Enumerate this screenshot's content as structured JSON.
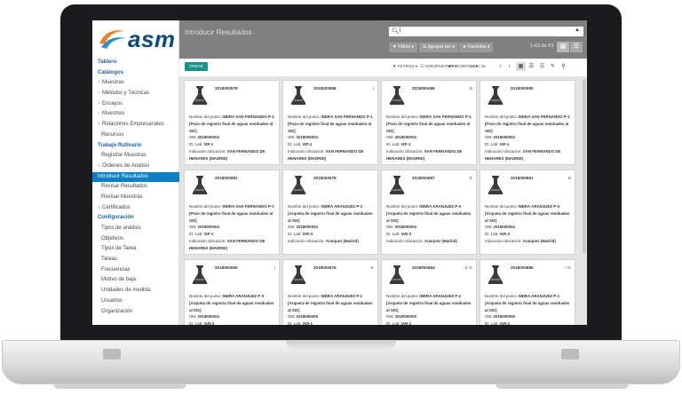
{
  "brand": {
    "logo_text": "asm"
  },
  "sidebar": {
    "items": [
      {
        "label": "Tablero",
        "kind": "section"
      },
      {
        "label": "Catálogos",
        "kind": "section"
      },
      {
        "label": "Muestras",
        "kind": "caret"
      },
      {
        "label": "Métodos y Técnicas",
        "kind": "caret"
      },
      {
        "label": "Ensayos",
        "kind": "caret"
      },
      {
        "label": "Muestreo",
        "kind": "caret"
      },
      {
        "label": "Relaciones Empresariales",
        "kind": "caret"
      },
      {
        "label": "Recursos",
        "kind": "sub"
      },
      {
        "label": "Trabajo Rutinario",
        "kind": "section"
      },
      {
        "label": "Registrar Muestras",
        "kind": "sub"
      },
      {
        "label": "Órdenes de Análisis",
        "kind": "caret"
      },
      {
        "label": "Introducir Resultados",
        "kind": "active"
      },
      {
        "label": "Revisar Resultados",
        "kind": "sub"
      },
      {
        "label": "Revisar Muestras",
        "kind": "sub"
      },
      {
        "label": "Certificados",
        "kind": "caret"
      },
      {
        "label": "Configuración",
        "kind": "section"
      },
      {
        "label": "Tipos de análisis",
        "kind": "sub"
      },
      {
        "label": "Objetivos",
        "kind": "sub"
      },
      {
        "label": "Tipos de Tarea",
        "kind": "sub"
      },
      {
        "label": "Tareas",
        "kind": "sub"
      },
      {
        "label": "Frecuencias",
        "kind": "sub"
      },
      {
        "label": "Motivo de baja",
        "kind": "sub"
      },
      {
        "label": "Unidades de medida",
        "kind": "sub"
      },
      {
        "label": "Usuarios",
        "kind": "sub"
      },
      {
        "label": "Organización",
        "kind": "sub"
      }
    ]
  },
  "topbar": {
    "title": "Introducir Resultados",
    "search_icon": "search-icon",
    "search_value": "|",
    "filters_label": "▼ Filtros ▾",
    "group_label": "☰ Agrupar por ▾",
    "favorites_label": "★ Favoritos ▾",
    "pager": "1-63 de 63"
  },
  "subbar": {
    "create_label": "CREAR",
    "filters_label": "▼ FILTROS ▾",
    "group_label": "☰ AGRUPAR POR ▾",
    "favorites_label": "★ FAVORITOS ▾",
    "pager": "1-15 / 15"
  },
  "cards": [
    {
      "code": "2018000579",
      "tag": "",
      "point": "INDRA SAN FERNANDO P-1",
      "desc": "[Pozo de registro final de aguas residuales al SIS]",
      "om": "2018000004",
      "lab": "ISF-1",
      "loc": "SAN FERNANDO DE HENARES (MADRID)"
    },
    {
      "code": "2018000588",
      "tag": "I",
      "point": "INDRA SAN FERNANDO P-1",
      "desc": "[Pozo de registro final de aguas residuales al SIS]",
      "om": "2018000004",
      "lab": "ISF-1",
      "loc": "SAN FERNANDO DE HENARES (MADRID)"
    },
    {
      "code": "2018000489",
      "tag": "B",
      "point": "INDRA SAN FERNANDO P-1",
      "desc": "[Pozo de registro final de aguas residuales al SIS]",
      "om": "2018000004",
      "lab": "ISF-1",
      "loc": "SAN FERNANDO DE HENARES (MADRID)"
    },
    {
      "code": "2018000580",
      "tag": "",
      "point": "INDRA SAN FERNANDO P-1",
      "desc": "[Pozo de registro final de aguas residuales al SIS]",
      "om": "2018000004",
      "lab": "ISF-1",
      "loc": "SAN FERNANDO DE HENARES (MADRID)"
    },
    {
      "code": "2018000581",
      "tag": "",
      "point": "INDRA SAN FERNANDO P-1",
      "desc": "[Pozo de registro final de aguas residuales al SIS]",
      "om": "2018000004",
      "lab": "ISF-1",
      "loc": "SAN FERNANDO DE HENARES (MADRID)"
    },
    {
      "code": "2018000578",
      "tag": "",
      "point": "INDRA ARANJUEZ P-3",
      "desc": "[Arqueta de registro final de aguas residuales al SIS]",
      "om": "2018000004",
      "lab": "IAR-3",
      "loc": "Aranjuez (Madrid)"
    },
    {
      "code": "2018000687",
      "tag": "E",
      "point": "INDRA ARANJUEZ P-3",
      "desc": "[Arqueta de registro final de aguas residuales al SIS]",
      "om": "2018000004",
      "lab": "IAR-3",
      "loc": "Aranjuez (Madrid)"
    },
    {
      "code": "2018000691",
      "tag": "B",
      "point": "INDRA ARANJUEZ P-3",
      "desc": "[Arqueta de registro final de aguas residuales al SIS]",
      "om": "2018000004",
      "lab": "IAR-3",
      "loc": "Aranjuez (Madrid)"
    },
    {
      "code": "2018000690",
      "tag": "I",
      "point": "INDRA ARANJUEZ P-3",
      "desc": "[Arqueta de registro final de aguas residuales al SIS]",
      "om": "2018000004",
      "lab": "IAR-3",
      "loc": ""
    },
    {
      "code": "2018000576",
      "tag": "%",
      "point": "INDRA ARANJUEZ P-1",
      "desc": "[Arqueta de registro final de aguas residuales al SIS]",
      "om": "2018000005",
      "lab": "IAR-1",
      "loc": ""
    },
    {
      "code": "2018000684",
      "tag": "E %",
      "point": "INDRA ARANJUEZ P-1",
      "desc": "[Arqueta de registro final de aguas residuales al SIS]",
      "om": "2018000005",
      "lab": "IAR-1",
      "loc": ""
    },
    {
      "code": "2018000685",
      "tag": "I %",
      "point": "INDRA ARANJUEZ P-1",
      "desc": "[Arqueta de registro final de aguas residuales al SIS]",
      "om": "2018000005",
      "lab": "IAR-1",
      "loc": ""
    }
  ],
  "labels": {
    "point": "Nombre del punto:",
    "om": "OM:",
    "lab": "ID. Lab:",
    "loc": "Indicación Ubicación:"
  },
  "colors": {
    "accent": "#0c7fc4",
    "create": "#16948a",
    "topbar": "#808080",
    "kanban_bg": "#e3e3e3"
  }
}
